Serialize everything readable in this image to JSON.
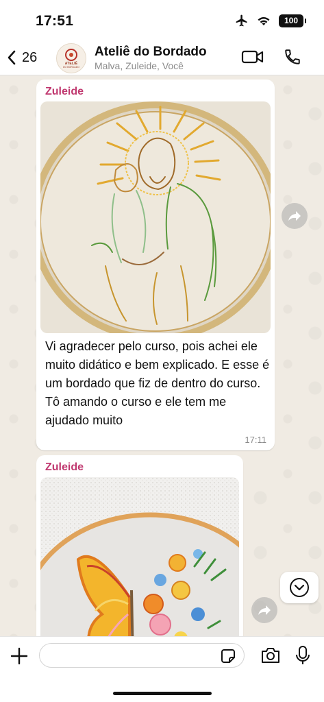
{
  "status_bar": {
    "time": "17:51",
    "battery": "100",
    "icons": [
      "airplane-icon",
      "wifi-icon",
      "battery-icon"
    ]
  },
  "header": {
    "back_count": "26",
    "title": "Ateliê do Bordado",
    "subtitle": "Malva, Zuleide, Você",
    "avatar_text": "ATELIÊ",
    "avatar_subtext": "DO BORDADO"
  },
  "messages": [
    {
      "sender": "Zuleide",
      "image": "embroidery-hoop-saint-joseph-child",
      "text": "Vi agradecer pelo curso, pois achei ele muito didático e bem explicado. E esse é um bordado que fiz de dentro do curso. Tô amando o curso e ele tem me ajudado muito",
      "time": "17:11"
    },
    {
      "sender": "Zuleide",
      "image": "embroidery-hoop-butterfly-flowers"
    }
  ],
  "input": {
    "value": "",
    "placeholder": ""
  },
  "colors": {
    "sender_name": "#c0386f",
    "chat_background": "#f0ebe3",
    "bubble": "#ffffff"
  }
}
